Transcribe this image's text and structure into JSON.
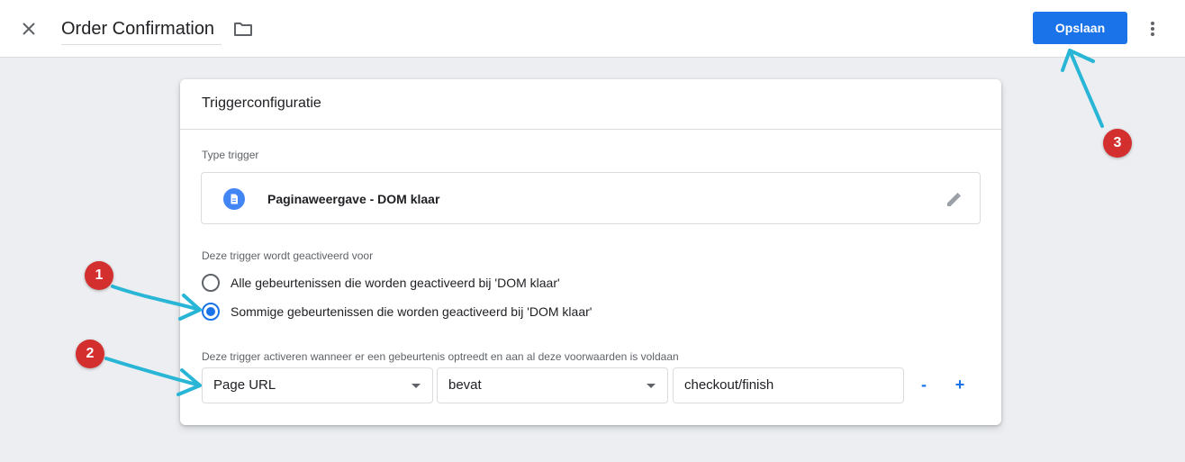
{
  "header": {
    "title": "Order Confirmation",
    "save_label": "Opslaan",
    "icons": [
      "close-icon",
      "folder-icon",
      "more-vert-icon"
    ]
  },
  "card": {
    "title": "Triggerconfiguratie",
    "trigger_type_label": "Type trigger",
    "trigger_type_name": "Paginaweergave - DOM klaar",
    "fires_on_label": "Deze trigger wordt geactiveerd voor",
    "options": [
      {
        "label": "Alle gebeurtenissen die worden geactiveerd bij 'DOM klaar'",
        "selected": false
      },
      {
        "label": "Sommige gebeurtenissen die worden geactiveerd bij 'DOM klaar'",
        "selected": true
      }
    ],
    "condition_label": "Deze trigger activeren wanneer er een gebeurtenis optreedt en aan al deze voorwaarden is voldaan",
    "condition": {
      "variable": "Page URL",
      "operator": "bevat",
      "value": "checkout/finish"
    },
    "remove_label": "-",
    "add_label": "+"
  },
  "annotations": [
    {
      "number": "1"
    },
    {
      "number": "2"
    },
    {
      "number": "3"
    }
  ],
  "colors": {
    "accent": "#1a73e8",
    "annotation_arrow": "#29b6d6",
    "annotation_badge": "#d32f2f",
    "background": "#eceef1"
  }
}
